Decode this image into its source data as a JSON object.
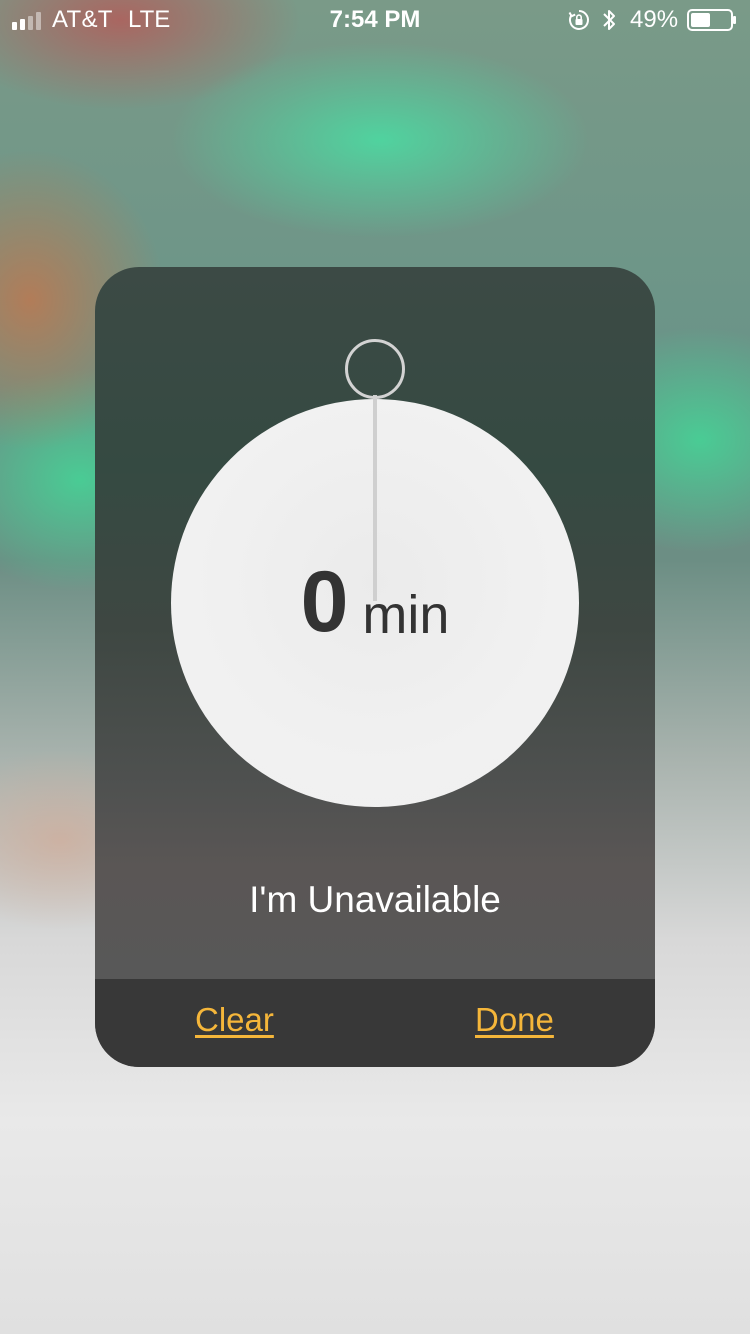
{
  "status_bar": {
    "carrier": "AT&T",
    "network": "LTE",
    "time": "7:54 PM",
    "battery_percent": "49%",
    "battery_level": 0.49,
    "signal_bars_on": 2,
    "signal_bars_total": 4,
    "icons": [
      "signal-icon",
      "orientation-lock-icon",
      "bluetooth-icon",
      "battery-icon"
    ]
  },
  "dialog": {
    "dial_value": "0",
    "dial_unit": "min",
    "status_label": "I'm Unavailable",
    "clear_label": "Clear",
    "done_label": "Done"
  },
  "colors": {
    "accent": "#f5b63a",
    "card_footer": "#383838",
    "dial": "#f0f0f0",
    "dial_text": "#333333"
  }
}
